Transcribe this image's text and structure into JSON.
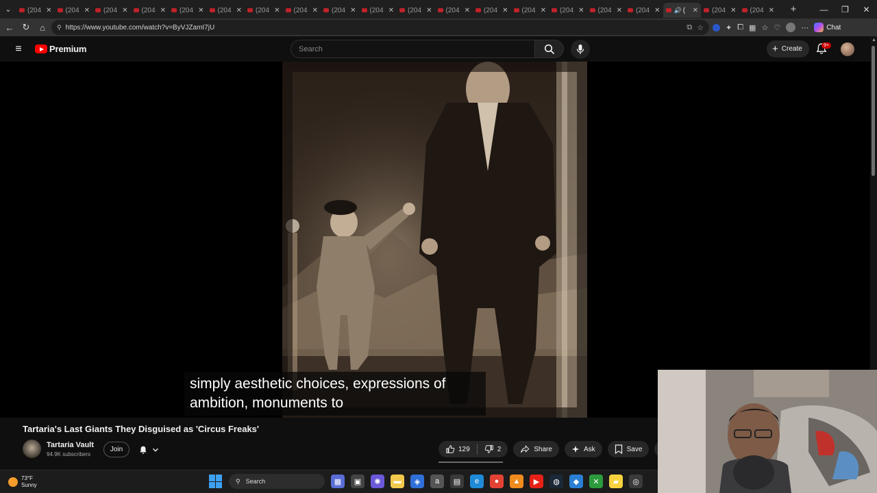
{
  "browser": {
    "tab_label": "(204",
    "tab_count_before_active": 17,
    "tab_count_after_active": 2,
    "active_tab_label": "(",
    "url": "https://www.youtube.com/watch?v=ByVJZamI7jU",
    "chat_label": "Chat"
  },
  "masthead": {
    "logo_text": "Premium",
    "search_placeholder": "Search",
    "create_label": "Create",
    "notification_badge": "9+"
  },
  "video": {
    "caption_line1": "simply aesthetic choices, expressions of",
    "caption_line2": "ambition, monuments to",
    "title": "Tartaria's Last Giants They Disguised as 'Circus Freaks'",
    "channel_name": "Tartaria Vault",
    "subscribers": "94.9K subscribers",
    "join_label": "Join",
    "like_count": "129",
    "dislike_count": "2",
    "share_label": "Share",
    "ask_label": "Ask",
    "save_label": "Save"
  },
  "taskbar": {
    "temperature": "73°F",
    "condition": "Sunny",
    "search_label": "Search",
    "icons": [
      "widgets-icon",
      "task-view-icon",
      "copilot-icon",
      "file-explorer-icon",
      "store-icon",
      "amazon-icon",
      "calculator-icon",
      "edge-icon",
      "chrome-icon",
      "vlc-icon",
      "youtube-icon",
      "steam-icon",
      "app-icon",
      "xbox-icon",
      "sticky-notes-icon",
      "openai-icon"
    ]
  },
  "colors": {
    "background": "#0f0f0f",
    "youtube_red": "#ff0000",
    "windows_blue": "#3ea0f0"
  }
}
